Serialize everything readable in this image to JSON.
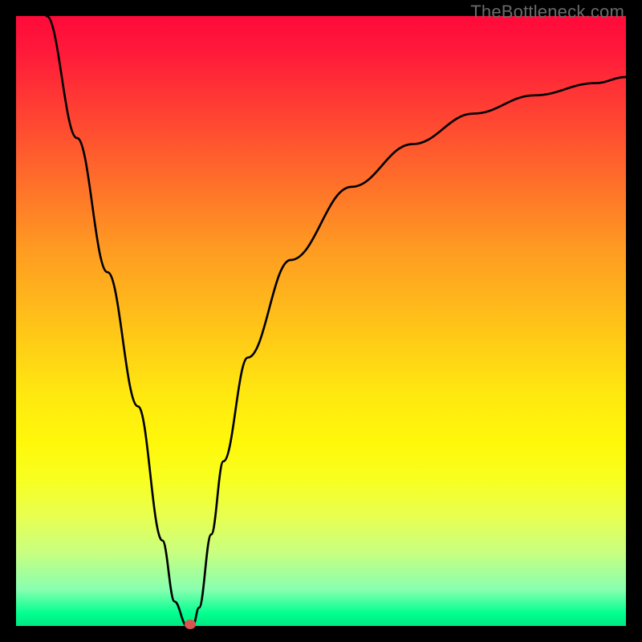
{
  "watermark": {
    "text": "TheBottleneck.com"
  },
  "chart_data": {
    "type": "line",
    "title": "",
    "xlabel": "",
    "ylabel": "",
    "xlim": [
      0,
      100
    ],
    "ylim": [
      0,
      100
    ],
    "grid": false,
    "series": [
      {
        "name": "bottleneck-curve",
        "x": [
          5,
          10,
          15,
          20,
          24,
          26,
          28,
          29,
          30,
          32,
          34,
          38,
          45,
          55,
          65,
          75,
          85,
          95,
          100
        ],
        "y": [
          100,
          80,
          58,
          36,
          14,
          4,
          0,
          0,
          3,
          15,
          27,
          44,
          60,
          72,
          79,
          84,
          87,
          89,
          90
        ]
      }
    ],
    "marker": {
      "x": 28.5,
      "y": 0,
      "color": "#d9534f"
    },
    "background_gradient": {
      "top": "#ff0a3a",
      "mid": "#ffe810",
      "bottom": "#00e880"
    }
  }
}
